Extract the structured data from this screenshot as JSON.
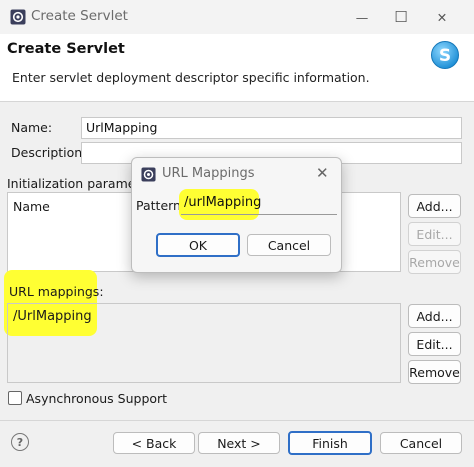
{
  "window": {
    "title": "Create Servlet",
    "minimize_glyph": "—",
    "maximize_glyph": "☐",
    "close_glyph": "✕"
  },
  "header": {
    "title": "Create Servlet",
    "description": "Enter servlet deployment descriptor specific information."
  },
  "form": {
    "name_label": "Name:",
    "name_value": "UrlMapping",
    "description_label": "Description:",
    "description_value": "",
    "init_params_label": "Initialization paramete",
    "init_params_column": "Name",
    "url_mappings_label": "URL mappings:",
    "url_mappings_items": [
      "/UrlMapping"
    ],
    "async_label": "Asynchronous Support"
  },
  "init_buttons": {
    "add": "Add...",
    "edit": "Edit...",
    "remove": "Remove"
  },
  "url_buttons": {
    "add": "Add...",
    "edit": "Edit...",
    "remove": "Remove"
  },
  "footer": {
    "help_glyph": "?",
    "back": "< Back",
    "next": "Next >",
    "finish": "Finish",
    "cancel": "Cancel"
  },
  "dialog": {
    "title": "URL Mappings",
    "close_glyph": "✕",
    "pattern_label": "Pattern:",
    "pattern_value": "/urlMapping",
    "ok": "OK",
    "cancel": "Cancel"
  },
  "colors": {
    "highlight": "#ffff33",
    "primary_border": "#2f6fc7"
  }
}
